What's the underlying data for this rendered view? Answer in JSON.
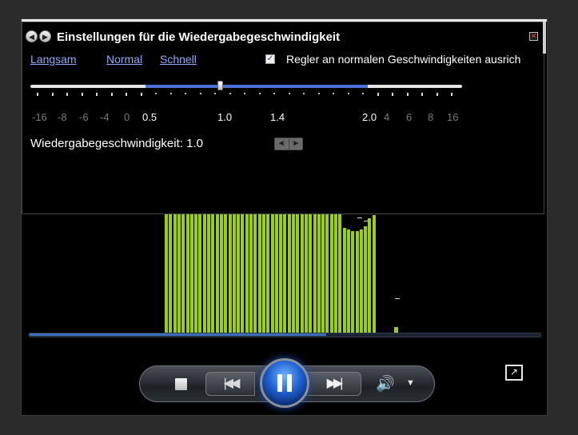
{
  "dialog": {
    "title": "Einstellungen für die Wiedergabegeschwindigkeit",
    "back_icon": "back-arrow-icon",
    "forward_icon": "forward-arrow-icon",
    "back_glyph": "◀",
    "forward_glyph": "▶",
    "close_glyph": "✕",
    "links": {
      "slow": "Langsam",
      "normal": "Normal",
      "fast": "Schnell"
    },
    "snap_checkbox": {
      "checked": true,
      "mark": "✓",
      "label": "Regler an normalen Geschwindigkeiten ausrich"
    },
    "slider": {
      "value": 1.0,
      "range_min": 0.5,
      "range_max": 2.0,
      "tick_labels": [
        "-16",
        "-8",
        "-6",
        "-4",
        "0",
        "0.5",
        "1.0",
        "1.4",
        "2.0",
        "4",
        "6",
        "8",
        "16"
      ]
    },
    "speed_readout": "Wiedergabegeschwindigkeit: 1.0",
    "step_back_glyph": "◀|",
    "step_forward_glyph": "|▶"
  },
  "seek": {
    "progress": 0.58
  },
  "transport": {
    "prev_glyph": "|◀◀",
    "next_glyph": "▶▶|",
    "volume_glyph": "🔊",
    "volume_menu_glyph": "▼",
    "compact_glyph": "↗"
  },
  "colors": {
    "visualization": "#9acd1c",
    "accent": "#4c70d8",
    "link": "#90a8ff",
    "background": "#000000"
  }
}
